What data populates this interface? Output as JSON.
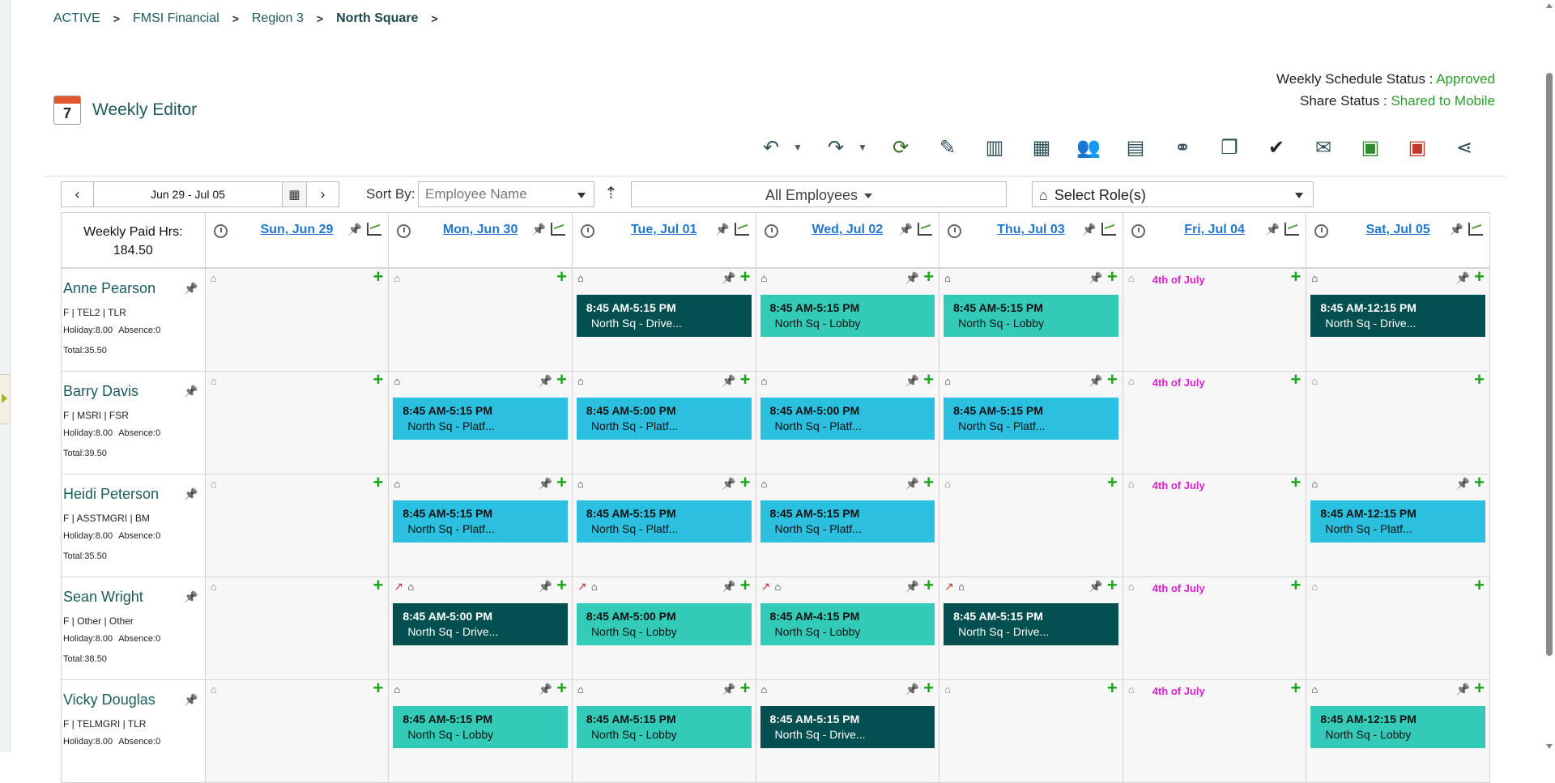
{
  "breadcrumb": [
    "ACTIVE",
    "FMSI Financial",
    "Region 3",
    "North Square"
  ],
  "status": {
    "weekly_label": "Weekly Schedule Status : ",
    "weekly_value": "Approved",
    "share_label": "Share Status : ",
    "share_value": "Shared to Mobile"
  },
  "page_title": "Weekly Editor",
  "page_icon_number": "7",
  "toolbar": {
    "icons": [
      "undo-icon",
      "undo-dropdown-icon",
      "redo-icon",
      "redo-dropdown-icon",
      "refresh-icon",
      "magic-wand-icon",
      "bar-chart-icon",
      "calendar-check-icon",
      "users-icon",
      "calendar-edit-icon",
      "binoculars-icon",
      "copy-icon",
      "checkmark-icon",
      "envelope-icon",
      "excel-icon",
      "pdf-icon",
      "share-icon"
    ]
  },
  "date_range": "Jun 29 - Jul 05",
  "sort": {
    "label": "Sort By:",
    "placeholder": "Employee Name"
  },
  "employee_filter": "All Employees",
  "role_filter": "Select Role(s)",
  "grid": {
    "paid_hours_label": "Weekly Paid Hrs:",
    "paid_hours_value": "184.50",
    "days": [
      "Sun, Jun 29",
      "Mon, Jun 30",
      "Tue, Jul 01",
      "Wed, Jul 02",
      "Thu, Jul 03",
      "Fri, Jul 04",
      "Sat, Jul 05"
    ],
    "holiday_label": "4th of July",
    "employees": [
      {
        "name": "Anne Pearson",
        "meta": "F | TEL2 | TLR",
        "holiday": "Holiday:8.00",
        "absence": "Absence:0",
        "total": "Total:35.50",
        "shifts": [
          null,
          null,
          {
            "time": "8:45 AM-5:15 PM",
            "loc": "North Sq - Drive...",
            "color": "dark"
          },
          {
            "time": "8:45 AM-5:15 PM",
            "loc": "North Sq - Lobby",
            "color": "teal"
          },
          {
            "time": "8:45 AM-5:15 PM",
            "loc": "North Sq - Lobby",
            "color": "teal"
          },
          null,
          {
            "time": "8:45 AM-12:15 PM",
            "loc": "North Sq - Drive...",
            "color": "dark"
          }
        ]
      },
      {
        "name": "Barry Davis",
        "meta": "F | MSRI | FSR",
        "holiday": "Holiday:8.00",
        "absence": "Absence:0",
        "total": "Total:39.50",
        "shifts": [
          null,
          {
            "time": "8:45 AM-5:15 PM",
            "loc": "North Sq - Platf...",
            "color": "blue"
          },
          {
            "time": "8:45 AM-5:00 PM",
            "loc": "North Sq - Platf...",
            "color": "blue"
          },
          {
            "time": "8:45 AM-5:00 PM",
            "loc": "North Sq - Platf...",
            "color": "blue"
          },
          {
            "time": "8:45 AM-5:15 PM",
            "loc": "North Sq - Platf...",
            "color": "blue"
          },
          null,
          null
        ]
      },
      {
        "name": "Heidi Peterson",
        "meta": "F | ASSTMGRI | BM",
        "holiday": "Holiday:8.00",
        "absence": "Absence:0",
        "total": "Total:35.50",
        "shifts": [
          null,
          {
            "time": "8:45 AM-5:15 PM",
            "loc": "North Sq - Platf...",
            "color": "blue"
          },
          {
            "time": "8:45 AM-5:15 PM",
            "loc": "North Sq - Platf...",
            "color": "blue"
          },
          {
            "time": "8:45 AM-5:15 PM",
            "loc": "North Sq - Platf...",
            "color": "blue"
          },
          null,
          null,
          {
            "time": "8:45 AM-12:15 PM",
            "loc": "North Sq - Platf...",
            "color": "blue"
          }
        ]
      },
      {
        "name": "Sean Wright",
        "meta": "F | Other | Other",
        "holiday": "Holiday:8.00",
        "absence": "Absence:0",
        "total": "Total:38.50",
        "shifts": [
          null,
          {
            "time": "8:45 AM-5:00 PM",
            "loc": "North Sq - Drive...",
            "color": "dark"
          },
          {
            "time": "8:45 AM-5:00 PM",
            "loc": "North Sq - Lobby",
            "color": "teal"
          },
          {
            "time": "8:45 AM-4:15 PM",
            "loc": "North Sq - Lobby",
            "color": "teal"
          },
          {
            "time": "8:45 AM-5:15 PM",
            "loc": "North Sq - Drive...",
            "color": "dark"
          },
          null,
          null
        ]
      },
      {
        "name": "Vicky Douglas",
        "meta": "F | TELMGRI | TLR",
        "holiday": "Holiday:8.00",
        "absence": "Absence:0",
        "total": "",
        "shifts": [
          null,
          {
            "time": "8:45 AM-5:15 PM",
            "loc": "North Sq - Lobby",
            "color": "teal"
          },
          {
            "time": "8:45 AM-5:15 PM",
            "loc": "North Sq - Lobby",
            "color": "teal"
          },
          {
            "time": "8:45 AM-5:15 PM",
            "loc": "North Sq - Drive...",
            "color": "dark"
          },
          null,
          null,
          {
            "time": "8:45 AM-12:15 PM",
            "loc": "North Sq - Lobby",
            "color": "teal"
          }
        ]
      }
    ]
  },
  "colors": {
    "dark": "#044f4f",
    "teal": "#33cbb8",
    "blue": "#2bbfe0",
    "holiday": "#e01fd3",
    "add": "#1aa51a"
  }
}
